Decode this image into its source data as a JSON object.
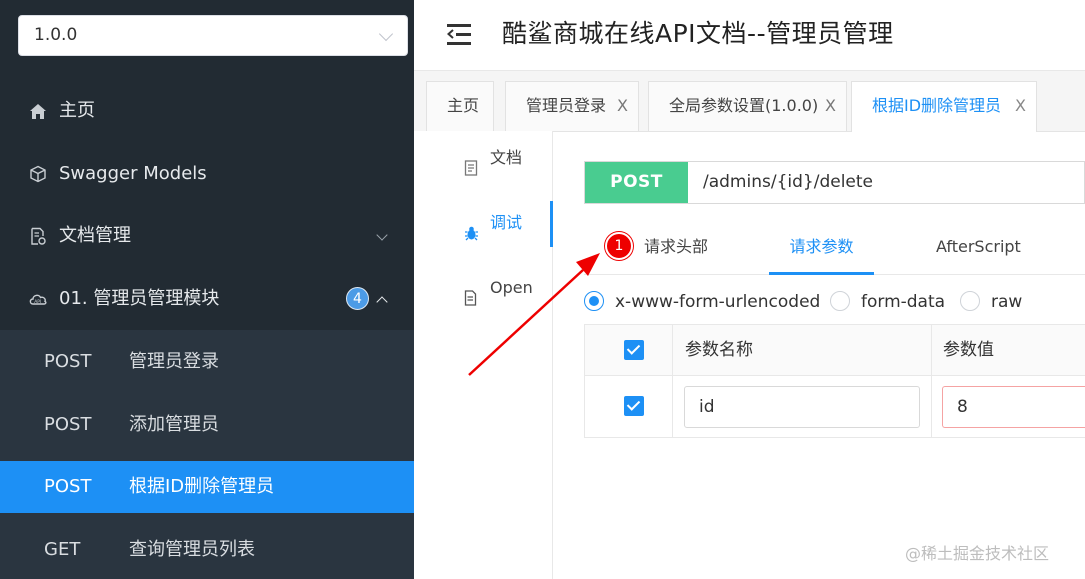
{
  "sidebar": {
    "version": "1.0.0",
    "items": [
      {
        "label": "主页",
        "icon": "home-icon"
      },
      {
        "label": "Swagger Models",
        "icon": "cube-icon"
      },
      {
        "label": "文档管理",
        "icon": "doc-settings-icon"
      },
      {
        "label": "01. 管理员管理模块",
        "icon": "cloud-icon",
        "badge": "4"
      }
    ],
    "apis": [
      {
        "method": "POST",
        "label": "管理员登录"
      },
      {
        "method": "POST",
        "label": "添加管理员"
      },
      {
        "method": "POST",
        "label": "根据ID删除管理员",
        "active": true
      },
      {
        "method": "GET",
        "label": "查询管理员列表"
      }
    ]
  },
  "header": {
    "title": "酷鲨商城在线API文档--管理员管理"
  },
  "tabs": [
    {
      "label": "主页",
      "closable": false
    },
    {
      "label": "管理员登录",
      "closable": true
    },
    {
      "label": "全局参数设置(1.0.0)",
      "closable": true
    },
    {
      "label": "根据ID删除管理员",
      "closable": true,
      "active": true
    }
  ],
  "close_glyph": "X",
  "docnav": [
    {
      "label": "文档"
    },
    {
      "label": "调试",
      "active": true
    },
    {
      "label": "Open"
    }
  ],
  "request": {
    "method": "POST",
    "url": "/admins/{id}/delete",
    "method_color": "#49cc90"
  },
  "subtabs": [
    {
      "label": "请求头部",
      "badge": "1"
    },
    {
      "label": "请求参数",
      "active": true
    },
    {
      "label": "AfterScript"
    }
  ],
  "content_types": [
    {
      "label": "x-www-form-urlencoded",
      "checked": true
    },
    {
      "label": "form-data",
      "checked": false
    },
    {
      "label": "raw",
      "checked": false
    }
  ],
  "params_table": {
    "headers": [
      "参数名称",
      "参数值"
    ],
    "rows": [
      {
        "checked": true,
        "name": "id",
        "value": "8"
      }
    ]
  },
  "watermark": "@稀土掘金技术社区",
  "colors": {
    "accent": "#1d90f5",
    "sidebar": "#222b33",
    "annotation": "#e00000"
  }
}
